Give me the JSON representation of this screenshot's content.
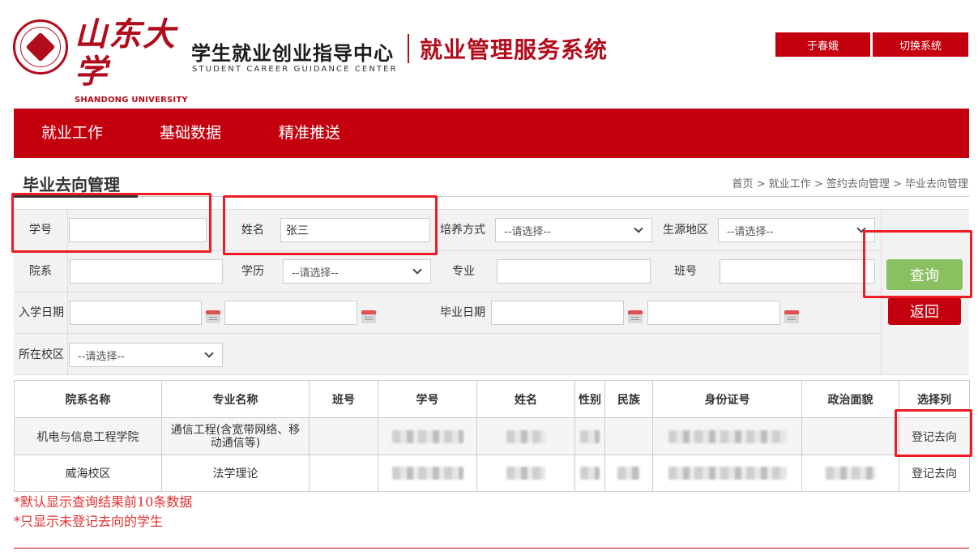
{
  "header": {
    "logo_univ_cn": "山东大学",
    "logo_univ_en": "SHANDONG UNIVERSITY",
    "center_name_cn": "学生就业创业指导中心",
    "center_name_en": "STUDENT CAREER GUIDANCE CENTER",
    "system_title": "就业管理服务系统",
    "user_name": "于春娥",
    "switch_system": "切换系统"
  },
  "nav": {
    "items": [
      "就业工作",
      "基础数据",
      "精准推送"
    ]
  },
  "page": {
    "title": "毕业去向管理",
    "breadcrumb": "首页 > 就业工作 > 签约去向管理 > 毕业去向管理"
  },
  "form": {
    "student_id_label": "学号",
    "student_id_value": "",
    "name_label": "姓名",
    "name_value": "张三",
    "training_label": "培养方式",
    "training_value": "--请选择--",
    "origin_label": "生源地区",
    "origin_value": "--请选择--",
    "dept_label": "院系",
    "dept_value": "",
    "degree_label": "学历",
    "degree_value": "--请选择--",
    "major_label": "专业",
    "major_value": "",
    "class_label": "班号",
    "class_value": "",
    "enroll_label": "入学日期",
    "enroll_from": "",
    "enroll_to": "",
    "grad_label": "毕业日期",
    "grad_from": "",
    "grad_to": "",
    "campus_label": "所在校区",
    "campus_value": "--请选择--",
    "query_button": "查询",
    "back_button": "返回"
  },
  "table": {
    "columns": [
      "院系名称",
      "专业名称",
      "班号",
      "学号",
      "姓名",
      "性别",
      "民族",
      "身份证号",
      "政治面貌",
      "选择列"
    ],
    "rows": [
      {
        "dept": "机电与信息工程学院",
        "major": "通信工程(含宽带网络、移动通信等)",
        "class": "",
        "action": "登记去向"
      },
      {
        "dept": "威海校区",
        "major": "法学理论",
        "class": "",
        "action": "登记去向"
      }
    ]
  },
  "notes": [
    "*默认显示查询结果前10条数据",
    "*只显示未登记去向的学生"
  ],
  "colors": {
    "brand_red": "#c4000e",
    "query_green": "#8bc060",
    "note_red": "#e03030",
    "highlight_red": "#ee1c24"
  }
}
